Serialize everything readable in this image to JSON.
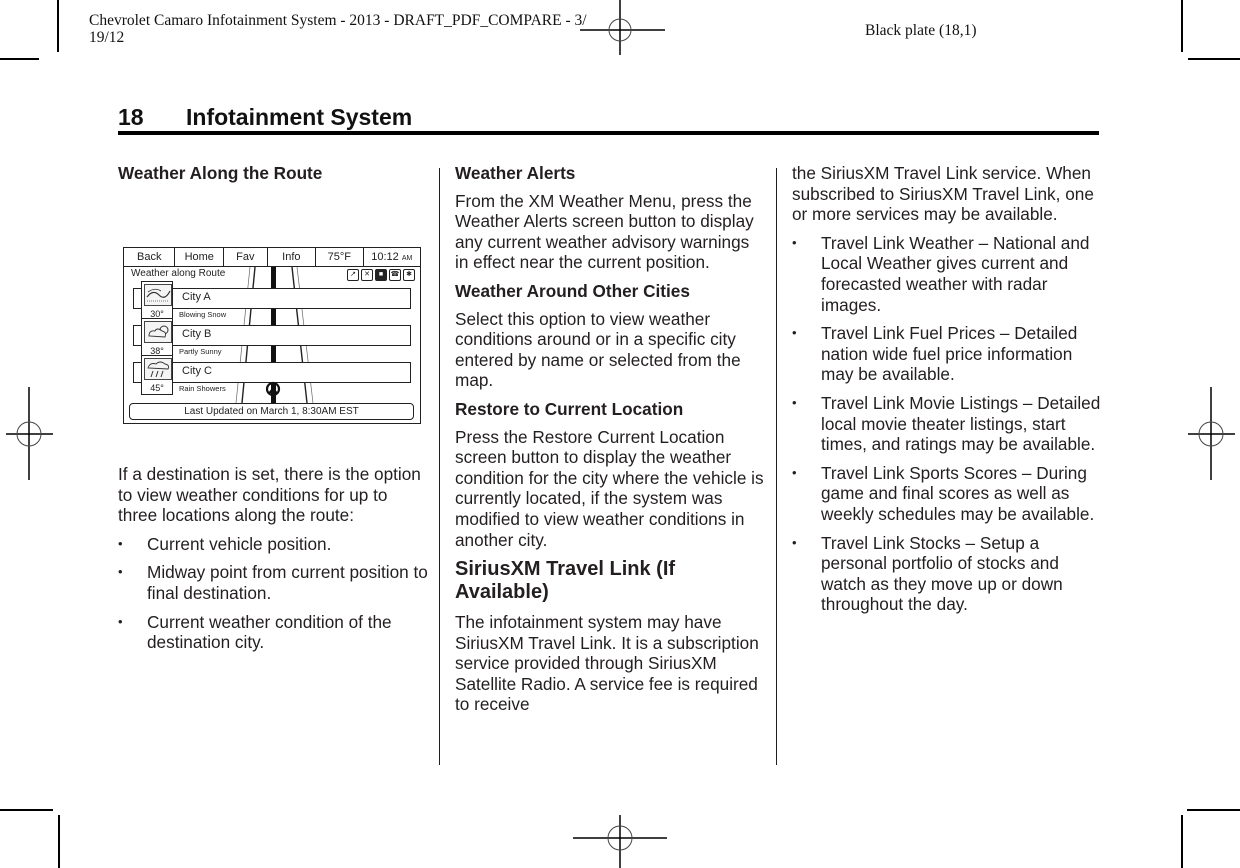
{
  "print_header": {
    "left_line1": "Chevrolet Camaro Infotainment System - 2013 - DRAFT_PDF_COMPARE - 3/",
    "left_line2": "19/12",
    "right": "Black plate (18,1)"
  },
  "page": {
    "number": "18",
    "section_title": "Infotainment System"
  },
  "column1": {
    "heading": "Weather Along the Route",
    "figure": {
      "tabs": [
        "Back",
        "Home",
        "Fav",
        "Info"
      ],
      "temperature": "75°F",
      "clock": "10:12",
      "clock_suffix": "AM",
      "screen_title": "Weather along Route",
      "status_icons": [
        "navigation-icon",
        "shuffle-icon",
        "mute-icon",
        "phone-icon",
        "bluetooth-icon"
      ],
      "cities": [
        {
          "name": "City A",
          "temp": "30°",
          "condition": "Blowing Snow",
          "icon": "snow-icon"
        },
        {
          "name": "City B",
          "temp": "38°",
          "condition": "Partly Sunny",
          "icon": "partly-sunny-icon"
        },
        {
          "name": "City C",
          "temp": "45°",
          "condition": "Rain Showers",
          "icon": "rain-icon"
        }
      ],
      "last_updated": "Last Updated on March 1, 8:30AM EST"
    },
    "intro": "If a destination is set, there is the option to view weather conditions for up to three locations along the route:",
    "bullets": [
      "Current vehicle position.",
      "Midway point from current position to final destination.",
      "Current weather condition of the destination city."
    ]
  },
  "column2": {
    "sections": [
      {
        "heading": "Weather Alerts",
        "text": "From the XM Weather Menu, press the Weather Alerts screen button to display any current weather advisory warnings in effect near the current position."
      },
      {
        "heading": "Weather Around Other Cities",
        "text": "Select this option to view weather conditions around or in a specific city entered by name or selected from the map."
      },
      {
        "heading": "Restore to Current Location",
        "text": "Press the Restore Current Location screen button to display the weather condition for the city where the vehicle is currently located, if the system was modified to view weather conditions in another city."
      }
    ],
    "major_heading": "SiriusXM Travel Link (If Available)",
    "travel_link_text": "The infotainment system may have SiriusXM Travel Link. It is a subscription service provided through SiriusXM Satellite Radio. A service fee is required to receive"
  },
  "column3": {
    "continued_text": "the SiriusXM Travel Link service. When subscribed to SiriusXM Travel Link, one or more services may be available.",
    "bullets": [
      "Travel Link Weather – National and Local Weather gives current and forecasted weather with radar images.",
      "Travel Link Fuel Prices – Detailed nation wide fuel price information may be available.",
      "Travel Link Movie Listings – Detailed local movie theater listings, start times, and ratings may be available.",
      "Travel Link Sports Scores – During game and final scores as well as weekly schedules may be available.",
      "Travel Link Stocks – Setup a personal portfolio of stocks and watch as they move up or down throughout the day."
    ]
  }
}
